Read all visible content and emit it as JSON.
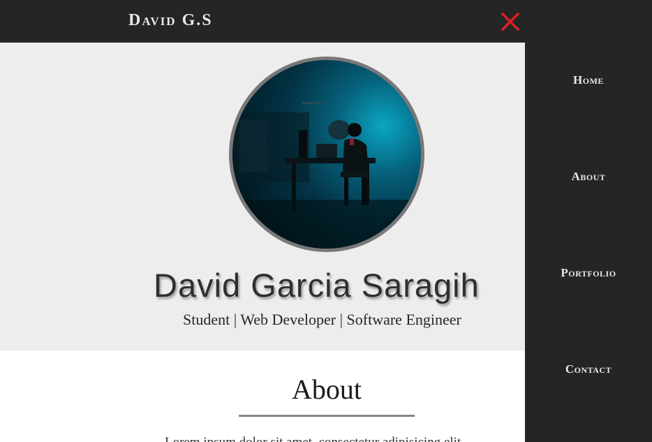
{
  "header": {
    "brand": "David G.S",
    "close_icon": "close-icon",
    "close_color": "#e01e1e"
  },
  "hero": {
    "avatar_alt": "Person working at a desk in a dark room",
    "name": "David Garcia Saragih",
    "tagline": "Student | Web Developer | Software Engineer"
  },
  "about": {
    "title": "About",
    "text": "Lorem ipsum dolor sit amet, consectetur adipisicing elit"
  },
  "sidenav": {
    "items": [
      {
        "label": "Home"
      },
      {
        "label": "About"
      },
      {
        "label": "Portfolio"
      },
      {
        "label": "Contact"
      }
    ]
  },
  "colors": {
    "dark": "#232625",
    "hero_bg": "#ededed",
    "accent_close": "#e01e1e"
  }
}
